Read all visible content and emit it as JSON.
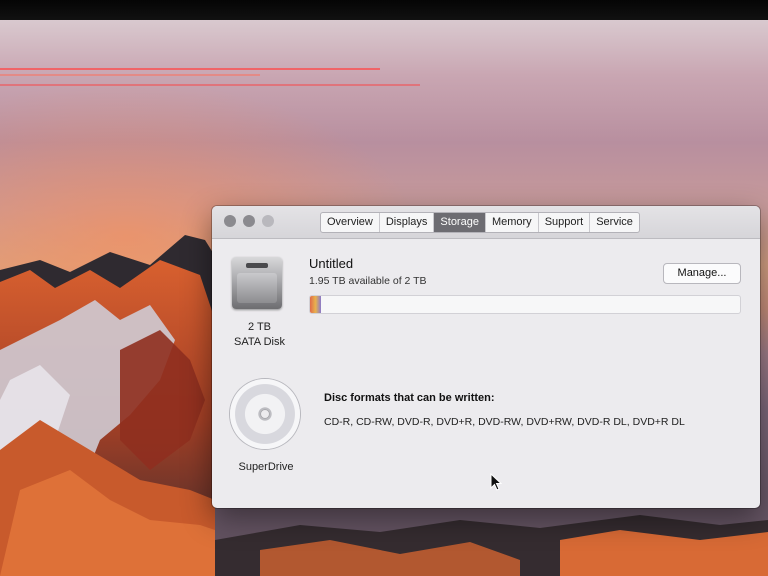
{
  "window": {
    "tabs": [
      "Overview",
      "Displays",
      "Storage",
      "Memory",
      "Support",
      "Service"
    ],
    "active_tab": "Storage"
  },
  "storage": {
    "disk": {
      "capacity": "2 TB",
      "type": "SATA Disk",
      "volume_name": "Untitled",
      "availability": "1.95 TB available of 2 TB",
      "used_fraction": 0.025,
      "manage_label": "Manage..."
    },
    "optical": {
      "name": "SuperDrive",
      "formats_title": "Disc formats that can be written:",
      "formats": "CD-R, CD-RW, DVD-R, DVD+R, DVD-RW, DVD+RW, DVD-R DL, DVD+R DL"
    }
  },
  "colors": {
    "active_tab": "#6d6c72",
    "window_bg": "#ecebee",
    "bar_used": "#e06b4a"
  },
  "icons": {
    "hard_disk": "hard-disk-icon",
    "optical_disc": "optical-disc-icon",
    "pointer": "mouse-pointer-icon"
  }
}
